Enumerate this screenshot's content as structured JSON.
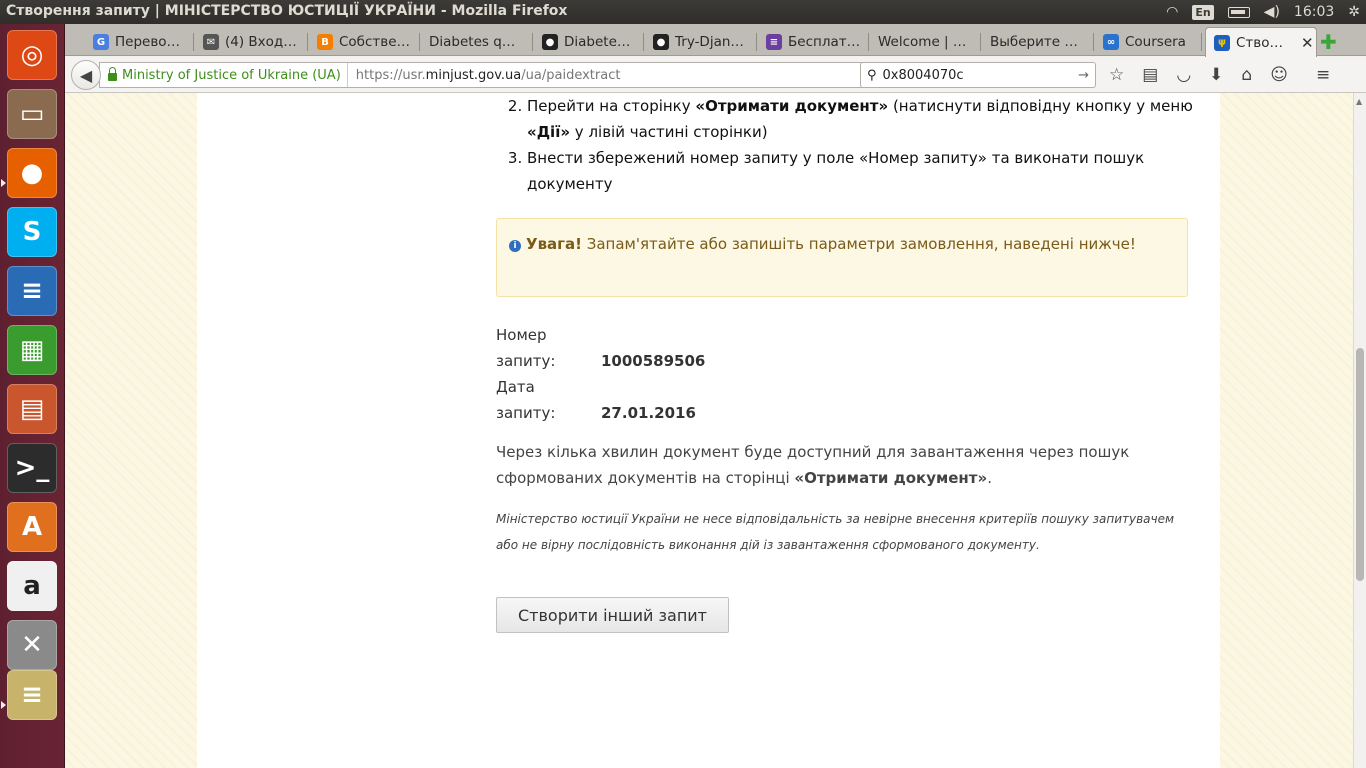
{
  "window": {
    "title": "Створення запиту | МІНІСТЕРСТВО ЮСТИЦІЇ УКРАЇНИ - Mozilla Firefox",
    "keyboard_layout": "En",
    "clock": "16:03"
  },
  "launcher": [
    {
      "name": "ubuntu-dash-icon",
      "color": "#dd4814",
      "glyph": "◎"
    },
    {
      "name": "files-icon",
      "color": "#8a6b4f",
      "glyph": "▭"
    },
    {
      "name": "firefox-icon",
      "color": "#e66000",
      "glyph": "●"
    },
    {
      "name": "skype-icon",
      "color": "#00aff0",
      "glyph": "S"
    },
    {
      "name": "libreoffice-writer-icon",
      "color": "#2a6bb5",
      "glyph": "≡"
    },
    {
      "name": "libreoffice-calc-icon",
      "color": "#3a9b2f",
      "glyph": "▦"
    },
    {
      "name": "libreoffice-impress-icon",
      "color": "#c9562d",
      "glyph": "▤"
    },
    {
      "name": "terminal-icon",
      "color": "#2c2c2c",
      "glyph": ">_"
    },
    {
      "name": "software-center-icon",
      "color": "#e0701e",
      "glyph": "A"
    },
    {
      "name": "amazon-icon",
      "color": "#f0f0f0",
      "glyph": "a"
    },
    {
      "name": "system-settings-icon",
      "color": "#8a8a8a",
      "glyph": "✕"
    },
    {
      "name": "workspace-stack-icon",
      "color": "#c8b36b",
      "glyph": "≡"
    }
  ],
  "tabs": [
    {
      "label": "Перево…",
      "fav_color": "#4a7fe0",
      "fav_glyph": "G"
    },
    {
      "label": "(4) Вход…",
      "fav_color": "#555555",
      "fav_glyph": "✉"
    },
    {
      "label": "Собстве…",
      "fav_color": "#f57d00",
      "fav_glyph": "B"
    },
    {
      "label": "Diabetes q…",
      "fav_color": "",
      "fav_glyph": ""
    },
    {
      "label": "Diabete…",
      "fav_color": "#222222",
      "fav_glyph": "●"
    },
    {
      "label": "Try-Djan…",
      "fav_color": "#222222",
      "fav_glyph": "●"
    },
    {
      "label": "Бесплат…",
      "fav_color": "#6b3fa0",
      "fav_glyph": "≡"
    },
    {
      "label": "Welcome | …",
      "fav_color": "",
      "fav_glyph": ""
    },
    {
      "label": "Выберите …",
      "fav_color": "",
      "fav_glyph": ""
    },
    {
      "label": "Coursera",
      "fav_color": "#2a73cc",
      "fav_glyph": "∞"
    }
  ],
  "active_tab": {
    "label": "Ство…",
    "fav_color": "#1d5fbf"
  },
  "navbar": {
    "site_identity": "Ministry of Justice of Ukraine (UA)",
    "url_prefix": "https://usr.",
    "url_domain": "minjust.gov.ua",
    "url_path": "/ua/paidextract",
    "search_value": "0x8004070c"
  },
  "content": {
    "steps": [
      {
        "pre": "Перейти на сторінку ",
        "b1": "«Отримати документ»",
        "mid": " (натиснути відповідну кнопку у меню ",
        "b2": "«Дії»",
        "post": " у лівій частині сторінки)"
      },
      {
        "pre": "Внести збережений номер запиту у поле «Номер запиту» та виконати пошук документу",
        "b1": "",
        "mid": "",
        "b2": "",
        "post": ""
      }
    ],
    "alert_strong": "Увага!",
    "alert_text": " Запам'ятайте або запишіть параметри замовлення, наведені нижче!",
    "request_number_label_1": "Номер",
    "request_number_label_2": "запиту:",
    "request_number": "1000589506",
    "request_date_label_1": "Дата",
    "request_date_label_2": "запиту:",
    "request_date": "27.01.2016",
    "info_pre": "Через кілька хвилин документ буде доступний для завантаження через пошук сформованих документів на сторінці ",
    "info_strong": "«Отримати документ»",
    "info_post": ".",
    "disclaimer": "Міністерство юстиції України не несе відповідальність за невірне внесення критеріїв пошуку запитувачем або не вірну послідовність виконання дій із завантаження сформованого документу.",
    "new_request_button": "Створити інший запит"
  }
}
